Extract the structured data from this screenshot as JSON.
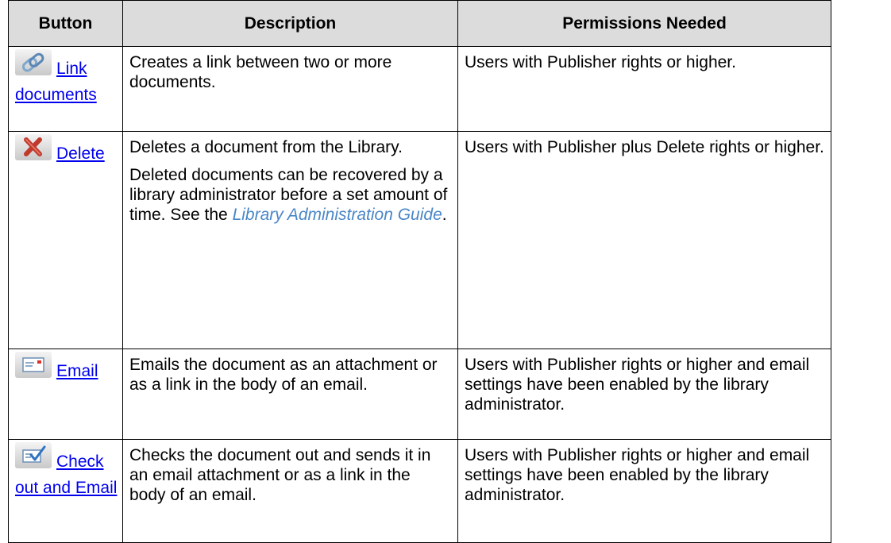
{
  "headers": {
    "button": "Button",
    "description": "Description",
    "permissions": "Permissions Needed"
  },
  "rows": [
    {
      "icon": "link-icon",
      "button_line1": "Link",
      "button_line2": "documents",
      "description": "Creates a link between two or more documents.",
      "permissions": "Users with Publisher rights or higher."
    },
    {
      "icon": "delete-x-icon",
      "button_line1": "Delete",
      "description": "Deletes a document from the Library.",
      "description_extra_before": "Deleted documents can be recovered by a library administrator before a set amount of time. See the ",
      "description_link": "Library Administration Guide",
      "description_extra_after": ".",
      "permissions": "Users with Publisher plus Delete rights or higher."
    },
    {
      "icon": "email-icon",
      "button_line1": "Email",
      "description": "Emails the document as an attachment or as a link in the body of an email.",
      "permissions": "Users with Publisher rights or higher and email settings have been enabled by the library administrator."
    },
    {
      "icon": "checkout-email-icon",
      "button_line1": "Check",
      "button_line2": "out and Email",
      "description": "Checks the document out and sends it in an email attachment or as a link in the body of an email.",
      "permissions": "Users with Publisher rights or higher and email settings have been enabled by the library administrator."
    }
  ],
  "colors": {
    "header_bg": "#dcdcdc",
    "link": "#0000ee",
    "guide_link": "#4a86c8",
    "border": "#000000"
  }
}
